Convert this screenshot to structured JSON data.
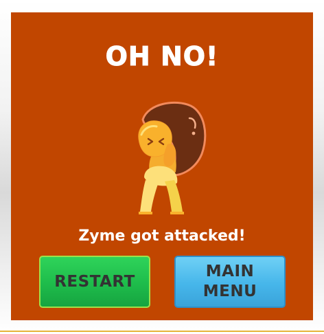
{
  "dialog": {
    "title": "OH NO!",
    "message": "Zyme got attacked!"
  },
  "buttons": {
    "restart_label": "RESTART",
    "main_menu_label": "MAIN\nMENU"
  },
  "colors": {
    "panel_background": "#c14600",
    "title_text": "#ffffff",
    "restart_button": "#1fbe4c",
    "main_menu_button": "#46b6ea",
    "button_text": "#333333"
  },
  "icons": {
    "character": "zyme-character-carrying-boulder-icon"
  }
}
